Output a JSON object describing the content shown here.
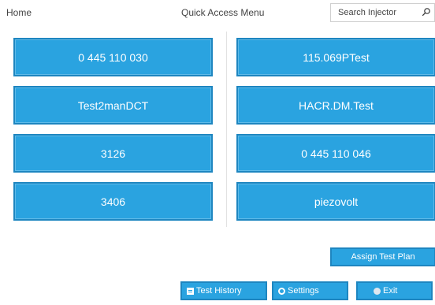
{
  "header": {
    "home": "Home",
    "title": "Quick Access Menu",
    "search_placeholder": "Search Injector"
  },
  "tiles": [
    "0 445 110 030",
    "115.069PTest",
    "Test2manDCT",
    "HACR.DM.Test",
    "3126",
    "0 445 110 046",
    "3406",
    "piezovolt"
  ],
  "buttons": {
    "assign": "Assign Test Plan",
    "history": "Test History",
    "settings": "Settings",
    "exit": "Exit"
  },
  "colors": {
    "tile": "#2aa3e0",
    "tile_border": "#1e86c0"
  }
}
